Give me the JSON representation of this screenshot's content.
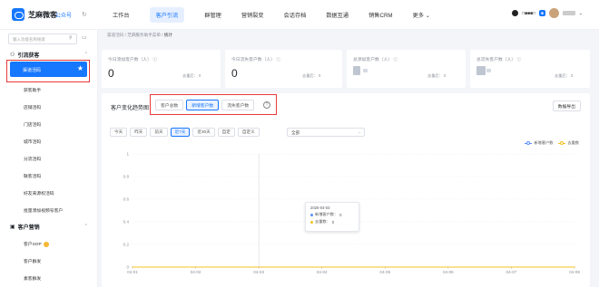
{
  "topbar": {
    "brand": "芝麻微客",
    "brand_sub": "公众号",
    "nav": [
      "工作台",
      "客户引流",
      "群管理",
      "营销裂变",
      "会话存档",
      "数据互通",
      "销售CRM",
      "更多 ⌄"
    ],
    "active_index": 1,
    "account_name": "□■■■□",
    "account_tag": "■",
    "chevron": "⌄"
  },
  "sidebar": {
    "search_placeholder": "输入功能名称搜索",
    "group1": "引流获客",
    "group1_items": [
      "渠道活码",
      "获客助手",
      "店铺活码",
      "门店活码",
      "城市活码",
      "分流活码",
      "联客活码",
      "好友来源权活码",
      "批量添加视频号客户"
    ],
    "active_item": "渠道活码",
    "group2": "客户营销",
    "group2_items": [
      "客户SOP",
      "客户群发",
      "素客群发"
    ]
  },
  "breadcrumb": {
    "parts": [
      "渠道活码",
      "芝麻服务助手菜单"
    ],
    "current": "统计"
  },
  "stats": [
    {
      "title": "今日添加客户数（人）",
      "value": "0",
      "sub_label": "去重后：",
      "sub_value": "0"
    },
    {
      "title": "今日流失客户数（人）",
      "value": "0",
      "sub_label": "去重后：",
      "sub_value": "0"
    },
    {
      "title": "总添加客户数（人）",
      "value": "",
      "sub_label": "去重后：",
      "sub_value": "0"
    },
    {
      "title": "总流失客户数（人）",
      "value": "",
      "sub_label": "去重后：",
      "sub_value": "0"
    }
  ],
  "panel": {
    "title": "客户变化趋势图",
    "tabs": [
      "客户总数",
      "新增客户数",
      "流失客户数"
    ],
    "active_tab": 1,
    "export_label": "数据导出",
    "ranges": [
      "今天",
      "昨天",
      "前天",
      "近7天",
      "近30天",
      "自定",
      "自定义"
    ],
    "active_range": 3,
    "select_value": "全部"
  },
  "tooltip": {
    "date": "2025-04-03",
    "rows": [
      {
        "label": "新增客户数：",
        "value": "0",
        "color": "#5b8ff9"
      },
      {
        "label": "去重数：",
        "value": "0",
        "color": "#f6c022"
      }
    ]
  },
  "chart_data": {
    "type": "line",
    "x": [
      "04-01",
      "04-02",
      "04-03",
      "04-04",
      "04-05",
      "04-06",
      "04-07",
      "04-08"
    ],
    "series": [
      {
        "name": "新增客户数",
        "values": [
          0,
          0,
          0,
          0,
          0,
          0,
          0,
          0
        ],
        "color": "#5b8ff9"
      },
      {
        "name": "去重数",
        "values": [
          0,
          0,
          0,
          0,
          0,
          0,
          0,
          0
        ],
        "color": "#f6c022"
      }
    ],
    "y_ticks": [
      "0",
      "0.2",
      "0.4",
      "0.6",
      "0.8",
      "1"
    ],
    "ylim": [
      0,
      1
    ],
    "highlight_x": "04-03",
    "legend_position": "top-right",
    "grid": true
  }
}
